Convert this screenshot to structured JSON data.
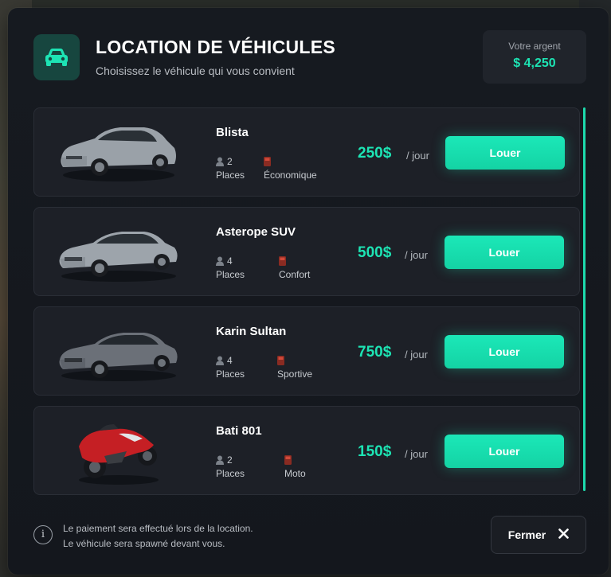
{
  "header": {
    "title": "LOCATION DE VÉHICULES",
    "subtitle": "Choisissez le véhicule qui vous convient",
    "icon": "car-icon"
  },
  "wallet": {
    "label": "Votre argent",
    "value": "$ 4,250"
  },
  "vehicles": [
    {
      "name": "Blista",
      "seats": "2",
      "seats_label": "Places",
      "category": "Économique",
      "price": "250$",
      "per": "/ jour",
      "button": "Louer",
      "image": "hatchback-car",
      "color": "#9aa1a8"
    },
    {
      "name": "Asterope SUV",
      "seats": "4",
      "seats_label": "Places",
      "category": "Confort",
      "price": "500$",
      "per": "/ jour",
      "button": "Louer",
      "image": "sedan-car",
      "color": "#9da4ab"
    },
    {
      "name": "Karin Sultan",
      "seats": "4",
      "seats_label": "Places",
      "category": "Sportive",
      "price": "750$",
      "per": "/ jour",
      "button": "Louer",
      "image": "sport-sedan-car",
      "color": "#6b7078"
    },
    {
      "name": "Bati 801",
      "seats": "2",
      "seats_label": "Places",
      "category": "Moto",
      "price": "150$",
      "per": "/ jour",
      "button": "Louer",
      "image": "sport-motorcycle",
      "color": "#c51f24"
    }
  ],
  "footer": {
    "info_line1": "Le paiement sera effectué lors de la location.",
    "info_line2": "Le véhicule sera spawné devant vous.",
    "close_label": "Fermer"
  },
  "colors": {
    "accent": "#1de4b4",
    "background": "#161a20",
    "card": "#1d2027"
  }
}
